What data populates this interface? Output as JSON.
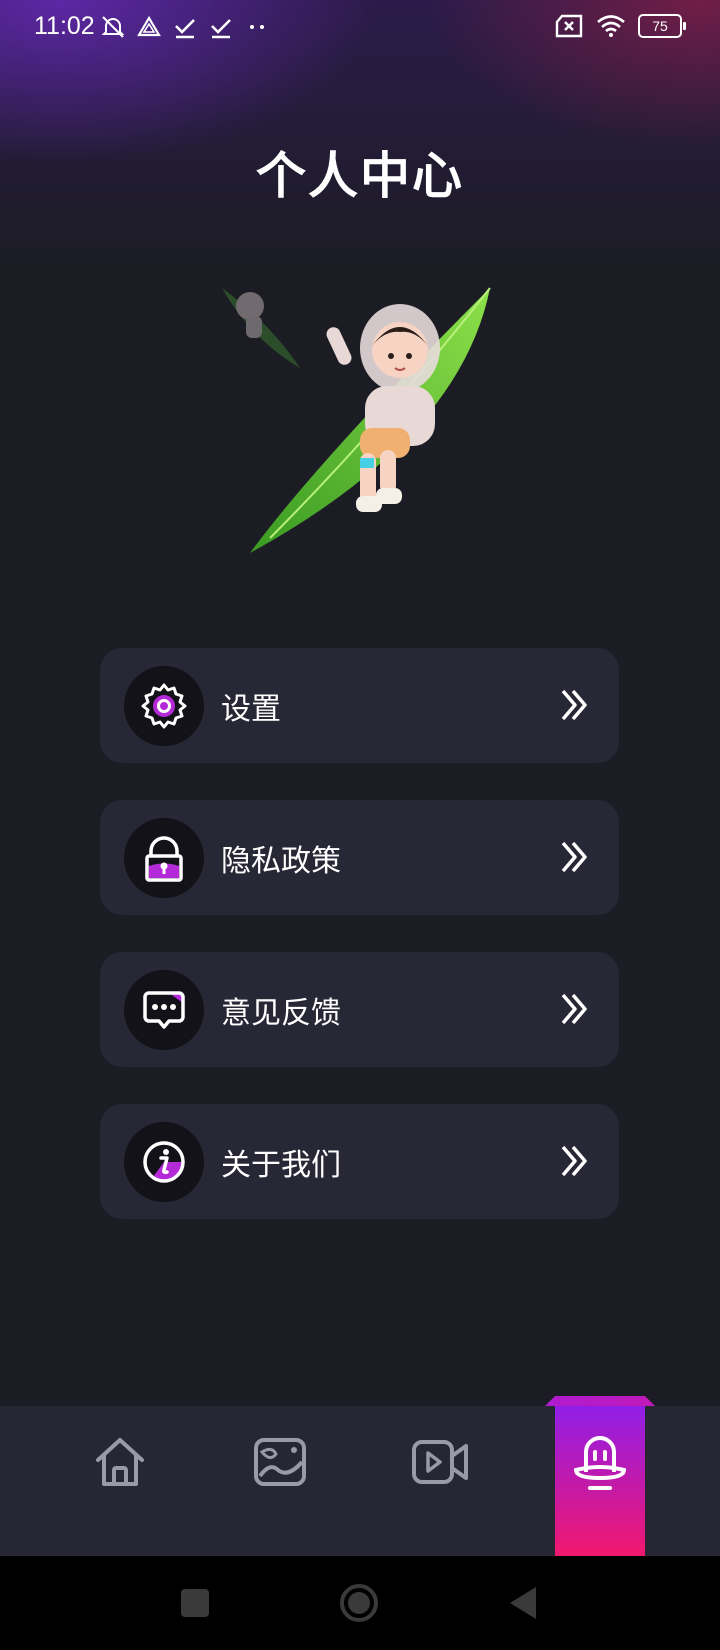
{
  "status_bar": {
    "time": "11:02",
    "battery": "75"
  },
  "page": {
    "title": "个人中心"
  },
  "menu": {
    "items": [
      {
        "label": "设置",
        "icon": "gear-icon"
      },
      {
        "label": "隐私政策",
        "icon": "lock-icon"
      },
      {
        "label": "意见反馈",
        "icon": "chat-icon"
      },
      {
        "label": "关于我们",
        "icon": "info-icon"
      }
    ]
  },
  "bottom_nav": {
    "items": [
      "home-icon",
      "gallery-icon",
      "video-icon",
      "profile-icon"
    ],
    "active_index": 3
  },
  "colors": {
    "background": "#1c1c25",
    "card": "#272735",
    "accent_gradient_start": "#8a1ff0",
    "accent_gradient_end": "#f3186f"
  }
}
